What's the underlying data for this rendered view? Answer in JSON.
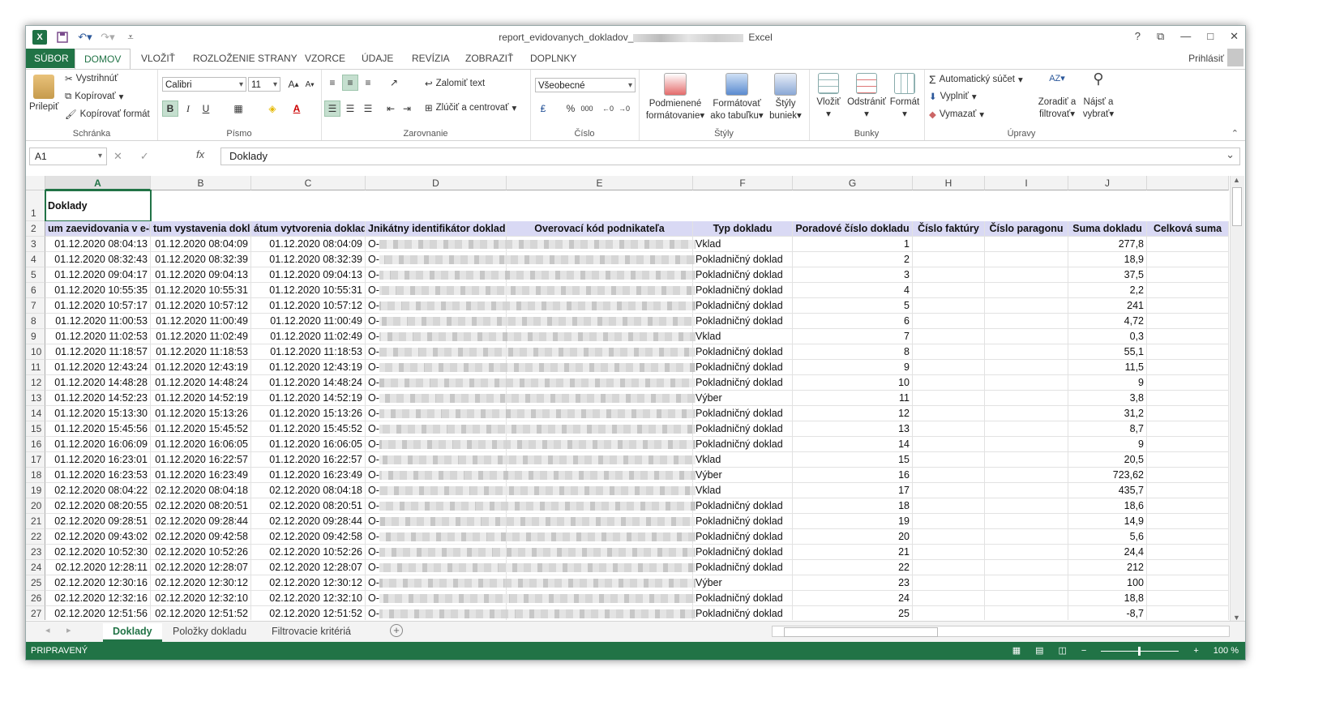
{
  "window": {
    "title_prefix": "report_evidovanych_dokladov_",
    "title_suffix": "Excel",
    "controls": [
      "?",
      "⧉",
      "—",
      "□",
      "✕"
    ]
  },
  "tabs": [
    "SÚBOR",
    "DOMOV",
    "VLOŽIŤ",
    "ROZLOŽENIE STRANY",
    "VZORCE",
    "ÚDAJE",
    "REVÍZIA",
    "ZOBRAZIŤ",
    "DOPLNKY"
  ],
  "signin": "Prihlásiť",
  "ribbon": {
    "clipboard": {
      "label": "Schránka",
      "paste": "Prilepiť",
      "cut": "Vystrihnúť",
      "copy": "Kopírovať",
      "format_painter": "Kopírovať formát"
    },
    "font": {
      "label": "Písmo",
      "name": "Calibri",
      "size": "11",
      "bold": "B",
      "italic": "I",
      "underline": "U"
    },
    "alignment": {
      "label": "Zarovnanie",
      "wrap": "Zalomiť text",
      "merge": "Zlúčiť a centrovať"
    },
    "number": {
      "label": "Číslo",
      "format": "Všeobecné",
      "percent": "%",
      "thousands": "000"
    },
    "styles": {
      "label": "Štýly",
      "cond1": "Podmienené",
      "cond2": "formátovanie",
      "table1": "Formátovať",
      "table2": "ako tabuľku",
      "cell1": "Štýly",
      "cell2": "buniek"
    },
    "cells": {
      "label": "Bunky",
      "insert": "Vložiť",
      "delete": "Odstrániť",
      "format": "Formát"
    },
    "editing": {
      "label": "Úpravy",
      "autosum": "Automatický súčet",
      "fill": "Vyplniť",
      "clear": "Vymazať",
      "sort1": "Zoradiť a",
      "sort2": "filtrovať",
      "find1": "Nájsť a",
      "find2": "vybrať"
    }
  },
  "formula_bar": {
    "name_box": "A1",
    "fx": "fx",
    "content": "Doklady"
  },
  "columns": [
    "A",
    "B",
    "C",
    "D",
    "E",
    "F",
    "G",
    "H",
    "I",
    "J"
  ],
  "title_cell": "Doklady",
  "header_row": [
    "um zaevidovania v e-k",
    "tum vystavenia dokla",
    "átum vytvorenia doklad",
    "Jnikátny identifikátor dokladu",
    "Overovací kód podnikateľa",
    "Typ dokladu",
    "Poradové číslo dokladu",
    "Číslo faktúry",
    "Číslo paragonu",
    "Suma dokladu",
    "Celková suma"
  ],
  "rows": [
    {
      "n": "3",
      "a": "01.12.2020 08:04:13",
      "b": "01.12.2020 08:04:09",
      "c": "01.12.2020 08:04:09",
      "d": "O-",
      "f": "Vklad",
      "g": "1",
      "j": "277,8"
    },
    {
      "n": "4",
      "a": "01.12.2020 08:32:43",
      "b": "01.12.2020 08:32:39",
      "c": "01.12.2020 08:32:39",
      "d": "O-",
      "f": "Pokladničný doklad",
      "g": "2",
      "j": "18,9"
    },
    {
      "n": "5",
      "a": "01.12.2020 09:04:17",
      "b": "01.12.2020 09:04:13",
      "c": "01.12.2020 09:04:13",
      "d": "O-",
      "f": "Pokladničný doklad",
      "g": "3",
      "j": "37,5"
    },
    {
      "n": "6",
      "a": "01.12.2020 10:55:35",
      "b": "01.12.2020 10:55:31",
      "c": "01.12.2020 10:55:31",
      "d": "O-",
      "f": "Pokladničný doklad",
      "g": "4",
      "j": "2,2"
    },
    {
      "n": "7",
      "a": "01.12.2020 10:57:17",
      "b": "01.12.2020 10:57:12",
      "c": "01.12.2020 10:57:12",
      "d": "O-",
      "f": "Pokladničný doklad",
      "g": "5",
      "j": "241"
    },
    {
      "n": "8",
      "a": "01.12.2020 11:00:53",
      "b": "01.12.2020 11:00:49",
      "c": "01.12.2020 11:00:49",
      "d": "O-",
      "f": "Pokladničný doklad",
      "g": "6",
      "j": "4,72"
    },
    {
      "n": "9",
      "a": "01.12.2020 11:02:53",
      "b": "01.12.2020 11:02:49",
      "c": "01.12.2020 11:02:49",
      "d": "O-",
      "f": "Vklad",
      "g": "7",
      "j": "0,3"
    },
    {
      "n": "10",
      "a": "01.12.2020 11:18:57",
      "b": "01.12.2020 11:18:53",
      "c": "01.12.2020 11:18:53",
      "d": "O-",
      "f": "Pokladničný doklad",
      "g": "8",
      "j": "55,1"
    },
    {
      "n": "11",
      "a": "01.12.2020 12:43:24",
      "b": "01.12.2020 12:43:19",
      "c": "01.12.2020 12:43:19",
      "d": "O-",
      "f": "Pokladničný doklad",
      "g": "9",
      "j": "11,5"
    },
    {
      "n": "12",
      "a": "01.12.2020 14:48:28",
      "b": "01.12.2020 14:48:24",
      "c": "01.12.2020 14:48:24",
      "d": "O-",
      "f": "Pokladničný doklad",
      "g": "10",
      "j": "9"
    },
    {
      "n": "13",
      "a": "01.12.2020 14:52:23",
      "b": "01.12.2020 14:52:19",
      "c": "01.12.2020 14:52:19",
      "d": "O-",
      "f": "Výber",
      "g": "11",
      "j": "3,8"
    },
    {
      "n": "14",
      "a": "01.12.2020 15:13:30",
      "b": "01.12.2020 15:13:26",
      "c": "01.12.2020 15:13:26",
      "d": "O-",
      "f": "Pokladničný doklad",
      "g": "12",
      "j": "31,2"
    },
    {
      "n": "15",
      "a": "01.12.2020 15:45:56",
      "b": "01.12.2020 15:45:52",
      "c": "01.12.2020 15:45:52",
      "d": "O-",
      "f": "Pokladničný doklad",
      "g": "13",
      "j": "8,7"
    },
    {
      "n": "16",
      "a": "01.12.2020 16:06:09",
      "b": "01.12.2020 16:06:05",
      "c": "01.12.2020 16:06:05",
      "d": "O-",
      "f": "Pokladničný doklad",
      "g": "14",
      "j": "9"
    },
    {
      "n": "17",
      "a": "01.12.2020 16:23:01",
      "b": "01.12.2020 16:22:57",
      "c": "01.12.2020 16:22:57",
      "d": "O-",
      "f": "Vklad",
      "g": "15",
      "j": "20,5"
    },
    {
      "n": "18",
      "a": "01.12.2020 16:23:53",
      "b": "01.12.2020 16:23:49",
      "c": "01.12.2020 16:23:49",
      "d": "O-",
      "f": "Výber",
      "g": "16",
      "j": "723,62"
    },
    {
      "n": "19",
      "a": "02.12.2020 08:04:22",
      "b": "02.12.2020 08:04:18",
      "c": "02.12.2020 08:04:18",
      "d": "O-",
      "f": "Vklad",
      "g": "17",
      "j": "435,7"
    },
    {
      "n": "20",
      "a": "02.12.2020 08:20:55",
      "b": "02.12.2020 08:20:51",
      "c": "02.12.2020 08:20:51",
      "d": "O-",
      "f": "Pokladničný doklad",
      "g": "18",
      "j": "18,6"
    },
    {
      "n": "21",
      "a": "02.12.2020 09:28:51",
      "b": "02.12.2020 09:28:44",
      "c": "02.12.2020 09:28:44",
      "d": "O-",
      "f": "Pokladničný doklad",
      "g": "19",
      "j": "14,9"
    },
    {
      "n": "22",
      "a": "02.12.2020 09:43:02",
      "b": "02.12.2020 09:42:58",
      "c": "02.12.2020 09:42:58",
      "d": "O-",
      "f": "Pokladničný doklad",
      "g": "20",
      "j": "5,6"
    },
    {
      "n": "23",
      "a": "02.12.2020 10:52:30",
      "b": "02.12.2020 10:52:26",
      "c": "02.12.2020 10:52:26",
      "d": "O-",
      "f": "Pokladničný doklad",
      "g": "21",
      "j": "24,4"
    },
    {
      "n": "24",
      "a": "02.12.2020 12:28:11",
      "b": "02.12.2020 12:28:07",
      "c": "02.12.2020 12:28:07",
      "d": "O-",
      "f": "Pokladničný doklad",
      "g": "22",
      "j": "212"
    },
    {
      "n": "25",
      "a": "02.12.2020 12:30:16",
      "b": "02.12.2020 12:30:12",
      "c": "02.12.2020 12:30:12",
      "d": "O-",
      "f": "Výber",
      "g": "23",
      "j": "100"
    },
    {
      "n": "26",
      "a": "02.12.2020 12:32:16",
      "b": "02.12.2020 12:32:10",
      "c": "02.12.2020 12:32:10",
      "d": "O-",
      "f": "Pokladničný doklad",
      "g": "24",
      "j": "18,8"
    },
    {
      "n": "27",
      "a": "02.12.2020 12:51:56",
      "b": "02.12.2020 12:51:52",
      "c": "02.12.2020 12:51:52",
      "d": "O-",
      "f": "Pokladničný doklad",
      "g": "25",
      "j": "-8,7"
    }
  ],
  "sheets": [
    "Doklady",
    "Položky dokladu",
    "Filtrovacie kritériá"
  ],
  "status": {
    "ready": "PRIPRAVENÝ",
    "zoom": "100 %"
  },
  "colors": {
    "accent": "#217346",
    "header_fill": "#d9d9f4"
  }
}
